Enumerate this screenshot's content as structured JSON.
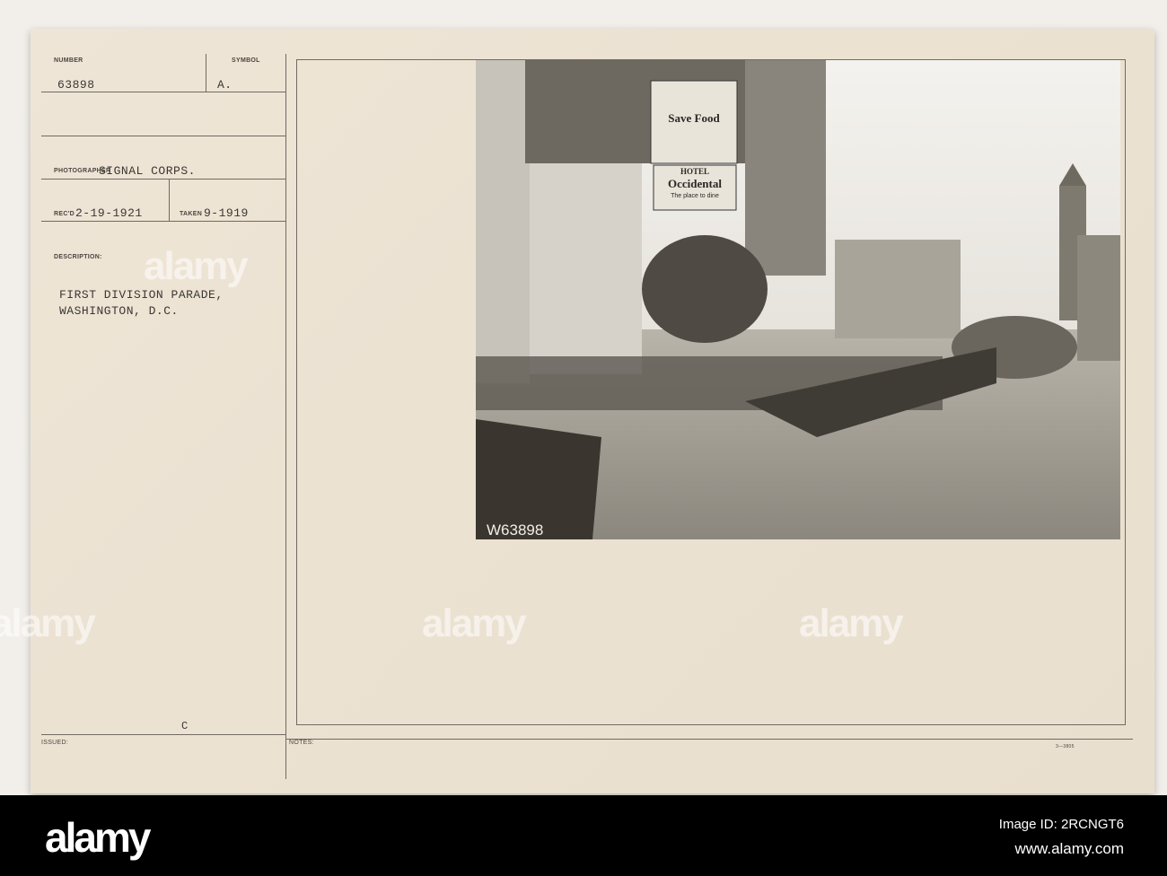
{
  "card": {
    "number_label": "NUMBER",
    "number_value": "63898",
    "symbol_label": "SYMBOL",
    "symbol_value": "A.",
    "photographer_label": "PHOTOGRAPHER",
    "photographer_value": "SIGNAL CORPS.",
    "received_label": "REC'D",
    "received_value": "2-19-1921",
    "taken_label": "TAKEN",
    "taken_value": "9-1919",
    "description_label": "DESCRIPTION:",
    "description_line1": "FIRST DIVISION PARADE,",
    "description_line2": "WASHINGTON, D.C.",
    "issued_label": "ISSUED:",
    "issued_mark": "C",
    "notes_label": "NOTES:",
    "form_number": "3—3805"
  },
  "photo": {
    "negative_number": "W63898",
    "billboard1_title": "Save Food",
    "billboard2_line1": "HOTEL",
    "billboard2_line2": "Occidental",
    "billboard2_line3": "The place to dine"
  },
  "watermark": {
    "text": "alamy"
  },
  "footer": {
    "logo": "alamy",
    "image_id": "Image ID: 2RCNGT6",
    "url": "www.alamy.com"
  }
}
